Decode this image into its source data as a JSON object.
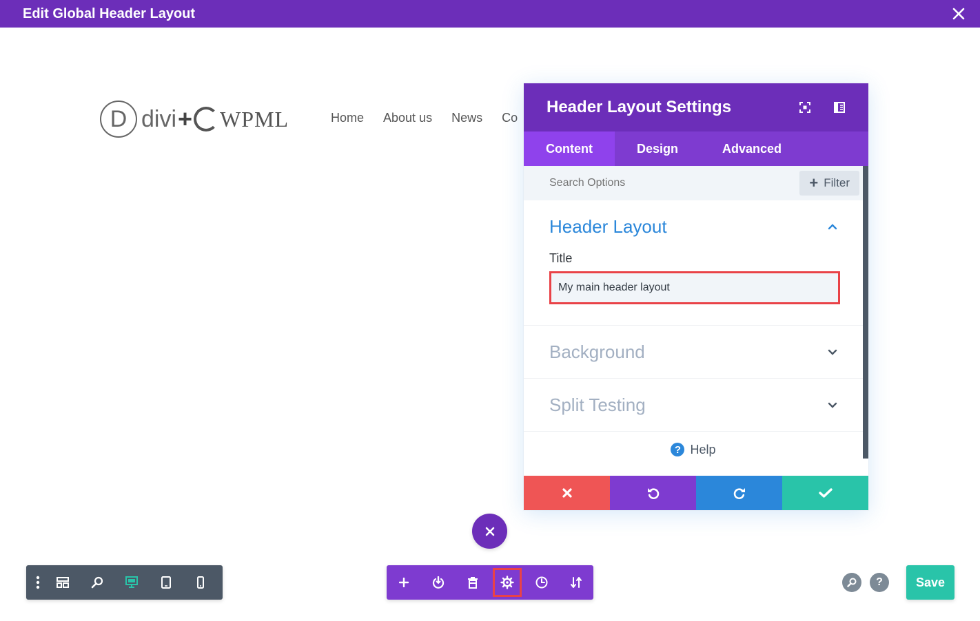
{
  "window": {
    "title": "Edit Global Header Layout",
    "close_icon": "close-icon"
  },
  "preview": {
    "logo": {
      "d_letter": "D",
      "divi": "divi",
      "plus": "+",
      "wpml": "WPML"
    },
    "nav": [
      "Home",
      "About us",
      "News",
      "Co"
    ]
  },
  "panel": {
    "title": "Header Layout Settings",
    "tabs": [
      "Content",
      "Design",
      "Advanced"
    ],
    "active_tab": "Content",
    "search_placeholder": "Search Options",
    "filter_label": "Filter",
    "sections": {
      "header_layout": {
        "title": "Header Layout",
        "field_label": "Title",
        "field_value": "My main header layout"
      },
      "background": {
        "title": "Background"
      },
      "split_testing": {
        "title": "Split Testing"
      }
    },
    "help_label": "Help",
    "footer_colors": {
      "discard": "#ef5555",
      "undo": "#7e3bd0",
      "redo": "#2b87da",
      "save": "#29c4a9"
    }
  },
  "bottom_left_bar": {
    "icons": [
      "more-vertical-icon",
      "layout-icon",
      "zoom-icon",
      "desktop-icon",
      "tablet-icon",
      "phone-icon"
    ]
  },
  "bottom_center_bar": {
    "icons": [
      "add-icon",
      "power-icon",
      "trash-icon",
      "gear-icon",
      "history-icon",
      "sort-icon"
    ]
  },
  "bottom_right": {
    "help_glyph": "?",
    "save_label": "Save"
  },
  "colors": {
    "brand_purple": "#6c2eb9",
    "tab_bar": "#7e3bd0",
    "active_tab": "#8f42ec",
    "accent_blue": "#2b87da",
    "highlight_red": "#e94247",
    "active_view_green": "#29c4a9"
  }
}
